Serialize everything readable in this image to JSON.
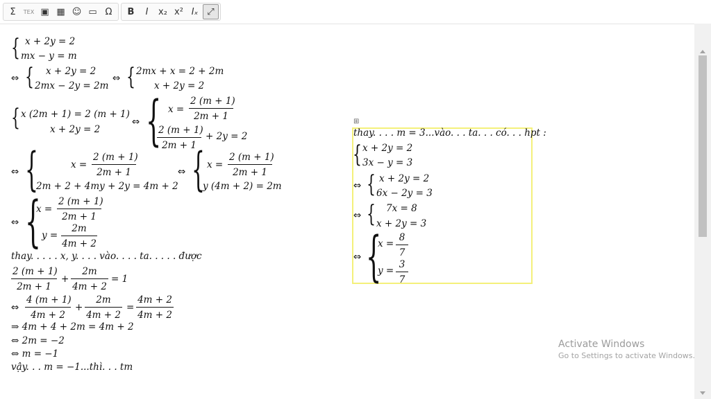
{
  "toolbar": {
    "group1": [
      {
        "name": "sum-icon",
        "glyph": "Σ"
      },
      {
        "name": "tex-icon",
        "glyph": "TEX"
      },
      {
        "name": "image-cut-icon",
        "glyph": "▣"
      },
      {
        "name": "table-icon",
        "glyph": "▦"
      },
      {
        "name": "emoji-icon",
        "glyph": "☺"
      },
      {
        "name": "image-icon",
        "glyph": "▭"
      },
      {
        "name": "omega-icon",
        "glyph": "Ω"
      }
    ],
    "group2": [
      {
        "name": "bold-button",
        "glyph": "B"
      },
      {
        "name": "italic-button",
        "glyph": "I"
      },
      {
        "name": "subscript-button",
        "glyph": "x₂"
      },
      {
        "name": "superscript-button",
        "glyph": "x²"
      },
      {
        "name": "remove-format-button",
        "glyph": "Iₓ"
      },
      {
        "name": "maximize-button",
        "glyph": "⤢"
      }
    ]
  },
  "left": {
    "sys1_l1": "x + 2y = 2",
    "sys1_l2": "mx − y = m",
    "eq2_arrow": "⇔",
    "sys2_l1": "x + 2y = 2",
    "sys2_l2": "2mx − 2y = 2m",
    "eq2_arrow2": "⇔",
    "sys3_l1": "2mx + x = 2 + 2m",
    "sys3_l2": "x + 2y = 2",
    "sys4_l1": "x (2m + 1) = 2 (m + 1)",
    "sys4_l2": "x + 2y = 2",
    "arrow4": "⇔",
    "sys5_x": "x =",
    "sys5_num": "2 (m + 1)",
    "sys5_den": "2m + 1",
    "sys5_l2_num": "2 (m + 1)",
    "sys5_l2_den": "2m + 1",
    "sys5_l2_tail": "+ 2y = 2",
    "arrow6": "⇔",
    "sys6_x": "x =",
    "sys6_num": "2 (m + 1)",
    "sys6_den": "2m + 1",
    "sys6_l2": "2m + 2 + 4my + 2y = 4m + 2",
    "arrow7": "⇔",
    "sys7_x": "x =",
    "sys7_num": "2 (m + 1)",
    "sys7_den": "2m + 1",
    "sys7_l2": "y (4m + 2) = 2m",
    "arrow8": "⇔",
    "sys8_x": "x =",
    "sys8_num": "2 (m + 1)",
    "sys8_den": "2m + 1",
    "sys8_y": "y =",
    "sys8_ynum": "2m",
    "sys8_yden": "4m + 2",
    "thay_line": "thay. . . . . x, y. . . . vào. . . . ta. . . . . được",
    "f1_num": "2 (m + 1)",
    "f1_den": "2m + 1",
    "f2_num": "2m",
    "f2_den": "4m + 2",
    "eq_tail": "= 1",
    "plus": "+",
    "arrow9": "⇔",
    "g1_num": "4 (m + 1)",
    "g1_den": "4m + 2",
    "g2_num": "2m",
    "g2_den": "4m + 2",
    "g3_num": "4m + 2",
    "g3_den": "4m + 2",
    "eqsign": "=",
    "line_a": "⇒ 4m + 4 + 2m = 4m + 2",
    "line_b": "⇔ 2m = −2",
    "line_c": "⇔ m = −1",
    "line_d": "vậy. . . m = −1...thì. . . tm"
  },
  "right": {
    "handle": "⊞",
    "title": "thay. . . . m = 3...vào. . . ta. . . có. . . hpt :",
    "s1_l1": "x + 2y = 2",
    "s1_l2": "3x − y = 3",
    "arrow1": "⇔",
    "s2_l1": "x + 2y = 2",
    "s2_l2": "6x − 2y = 3",
    "arrow2": "⇔",
    "s3_l1": "7x = 8",
    "s3_l2": "x + 2y = 3",
    "arrow3": "⇔",
    "s4_x": "x =",
    "s4_xnum": "8",
    "s4_xden": "7",
    "s4_y": "y =",
    "s4_ynum": "3",
    "s4_yden": "7"
  },
  "watermark": {
    "title": "Activate Windows",
    "subtitle": "Go to Settings to activate Windows."
  }
}
